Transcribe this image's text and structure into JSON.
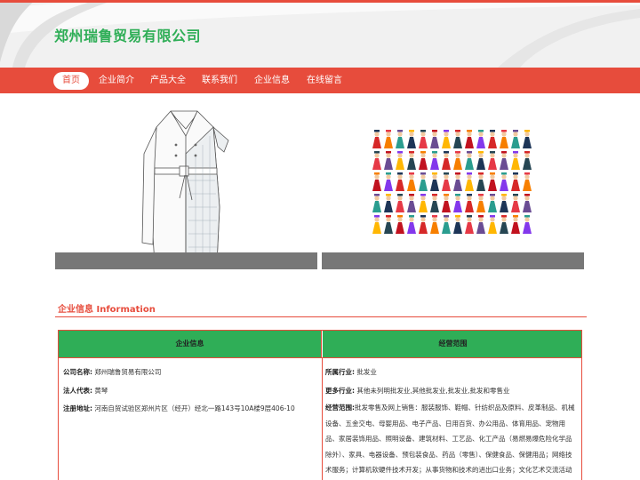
{
  "site": {
    "title": "郑州瑞鲁贸易有限公司"
  },
  "nav": {
    "items": [
      {
        "label": "首页",
        "active": true
      },
      {
        "label": "企业简介",
        "active": false
      },
      {
        "label": "产品大全",
        "active": false
      },
      {
        "label": "联系我们",
        "active": false
      },
      {
        "label": "企业信息",
        "active": false
      },
      {
        "label": "在线留言",
        "active": false
      }
    ]
  },
  "products": [
    {
      "icon": "trench-coat-image"
    },
    {
      "icon": "ethnic-dolls-image"
    }
  ],
  "section": {
    "title": "企业信息 Information"
  },
  "table": {
    "left_header": "企业信息",
    "right_header": "经营范围",
    "company_name_label": "公司名称:",
    "company_name": "郑州瑞鲁贸易有限公司",
    "legal_rep_label": "法人代表:",
    "legal_rep": "黄琴",
    "address_label": "注册地址:",
    "address": "河南自贸试验区郑州片区（经开）经北一路143号10A楼9层406-10",
    "industry_label": "所属行业:",
    "industry": "批发业",
    "more_industry_label": "更多行业:",
    "more_industry": "其他未列明批发业,其他批发业,批发业,批发和零售业",
    "scope_label": "经营范围:",
    "scope": "批发零售及网上销售：服装服饰、鞋帽、针纺织品及原料、皮革制品、机械设备、五金交电、母婴用品、电子产品、日用百货、办公用品、体育用品、宠物用品、家居装饰用品、照明设备、建筑材料、工艺品、化工产品（易燃易爆危险化学品除外）、家具、电器设备、预包装食品、药品（零售）、保健食品、保健用品；网络技术服务；计算机软硬件技术开发；从事货物和技术的进出口业务；文化艺术交流活动策划；会议及展览展示服务；"
  },
  "colors": {
    "brand_red": "#e74c3c",
    "brand_green": "#2fae57"
  }
}
